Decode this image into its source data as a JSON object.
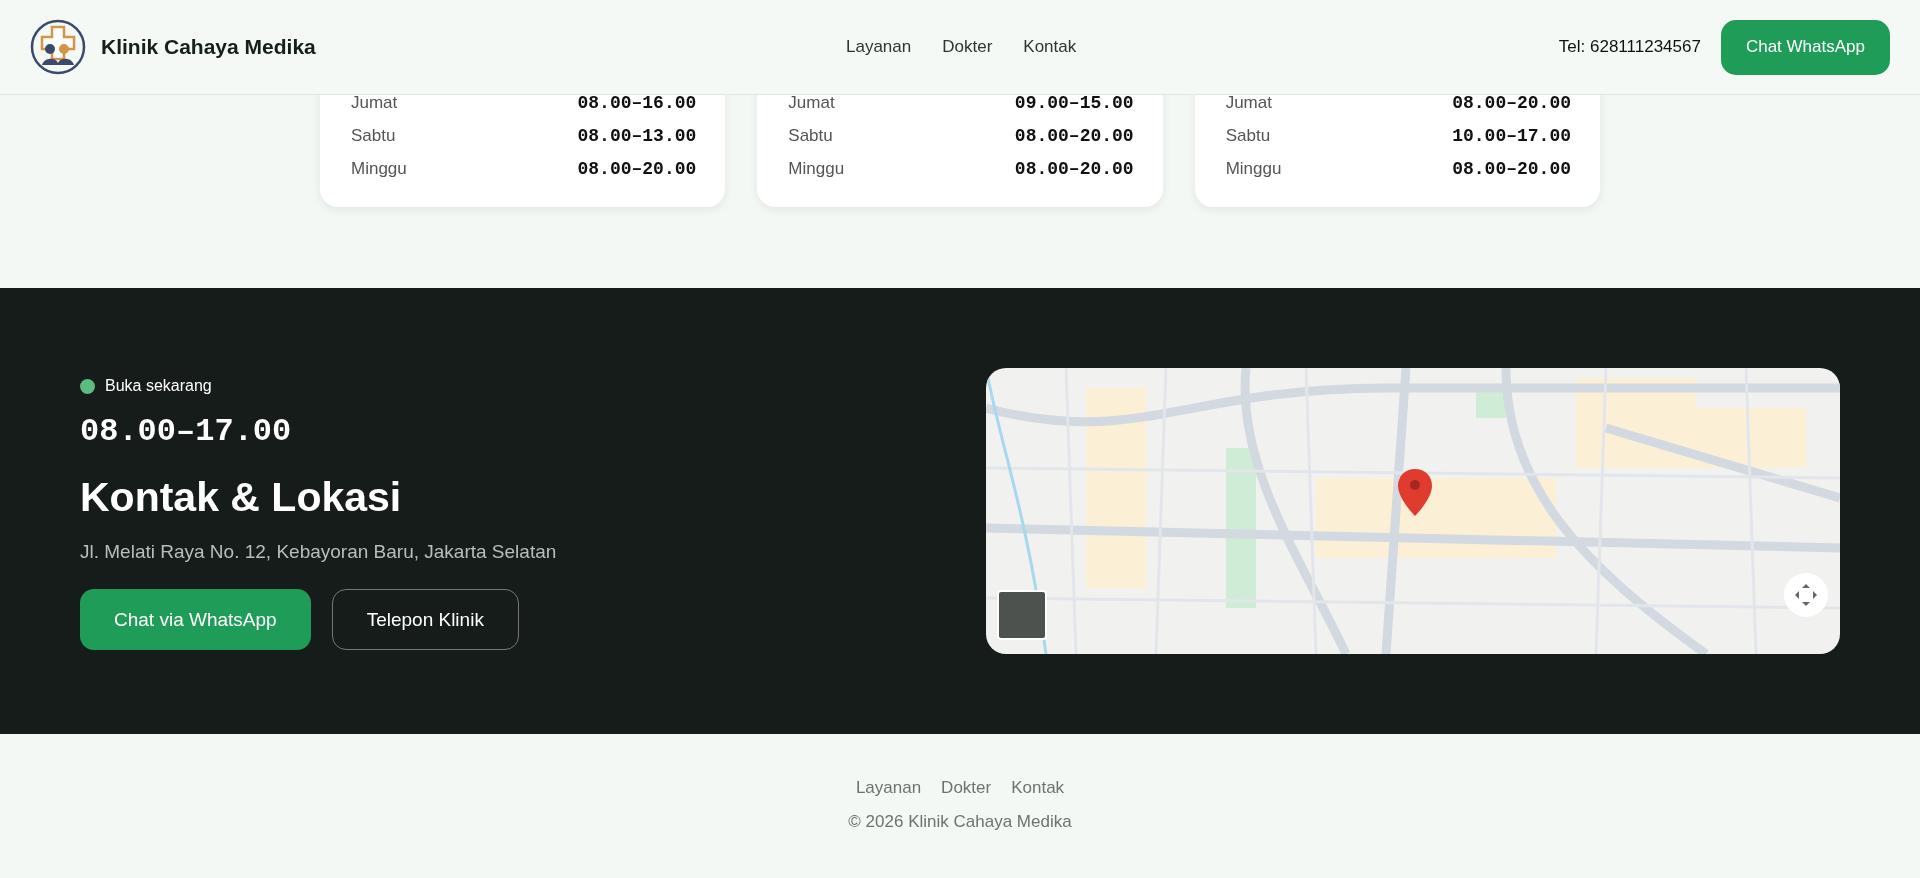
{
  "header": {
    "brand": "Klinik Cahaya Medika",
    "nav": [
      "Layanan",
      "Dokter",
      "Kontak"
    ],
    "phone": "Tel: 628111234567",
    "cta": "Chat WhatsApp"
  },
  "schedules": [
    {
      "rows": [
        {
          "day": "Jumat",
          "hours": "08.00–16.00"
        },
        {
          "day": "Sabtu",
          "hours": "08.00–13.00"
        },
        {
          "day": "Minggu",
          "hours": "08.00–20.00"
        }
      ]
    },
    {
      "rows": [
        {
          "day": "Jumat",
          "hours": "09.00–15.00"
        },
        {
          "day": "Sabtu",
          "hours": "08.00–20.00"
        },
        {
          "day": "Minggu",
          "hours": "08.00–20.00"
        }
      ]
    },
    {
      "rows": [
        {
          "day": "Jumat",
          "hours": "08.00–20.00"
        },
        {
          "day": "Sabtu",
          "hours": "10.00–17.00"
        },
        {
          "day": "Minggu",
          "hours": "08.00–20.00"
        }
      ]
    }
  ],
  "contact": {
    "status": "Buka sekarang",
    "hours": "08.00–17.00",
    "title": "Kontak & Lokasi",
    "address": "Jl. Melati Raya No. 12, Kebayoran Baru, Jakarta Selatan",
    "buttons": [
      {
        "label": "Chat via WhatsApp",
        "kind": "primary"
      },
      {
        "label": "Telepon Klinik",
        "kind": "outline"
      }
    ]
  },
  "footer": {
    "links": [
      "Layanan",
      "Dokter",
      "Kontak"
    ],
    "copyright": "© 2026 Klinik Cahaya Medika"
  }
}
